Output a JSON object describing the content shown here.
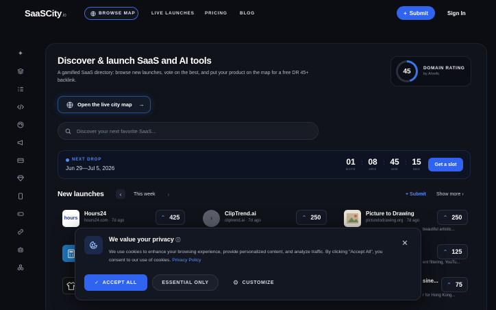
{
  "nav": {
    "logo_main": "SaaSCity",
    "logo_suffix": ".io",
    "browse_map": "BROWSE MAP",
    "live_launches": "LIVE LAUNCHES",
    "pricing": "PRICING",
    "blog": "BLOG",
    "submit": "Submit",
    "sign_in": "Sign In"
  },
  "sidebar": {
    "icons": [
      "sparkles-icon",
      "layers-icon",
      "list-check-icon",
      "code-icon",
      "palette-icon",
      "megaphone-icon",
      "credit-card-icon",
      "diamond-icon",
      "smartphone-icon",
      "gamepad-icon",
      "link-icon",
      "robot-icon",
      "shapes-icon"
    ]
  },
  "hero": {
    "title": "Discover & launch SaaS and AI tools",
    "subtitle": "A gamified SaaS directory: browse new launches, vote on the best, and put your product on the map for a free DR 45+ backlink.",
    "open_map": "Open the live city map",
    "search_placeholder": "Discover your next favorite SaaS..."
  },
  "domain_rating": {
    "value": "45",
    "label": "DOMAIN RATING",
    "by": "by Ahrefs",
    "ring_fraction": 0.45
  },
  "next_drop": {
    "tag": "NEXT DROP",
    "dates": "Jun 29—Jul 5, 2026",
    "days": "01",
    "days_label": "DAYS",
    "hrs": "08",
    "hrs_label": "HRS",
    "min": "45",
    "min_label": "MIN",
    "sec": "15",
    "sec_label": "SEC",
    "button": "Get a slot"
  },
  "launches": {
    "title": "New launches",
    "period": "This week",
    "submit": "Submit",
    "show_more": "Show more",
    "items": [
      {
        "name": "Hours24",
        "meta": "hours24.com · 7d ago",
        "votes": "425"
      },
      {
        "name": "ClipTrend.ai",
        "meta": "cliptrend.ai · 7d ago",
        "votes": "250"
      },
      {
        "name": "Picture to Drawing",
        "meta": "picturetodrawing.org · 7d ago",
        "votes": "250",
        "desc": "beautiful artistic..."
      },
      {
        "votes": "125",
        "desc": "ent filtering, YouTu..."
      },
      {
        "name": "sine...",
        "votes": "75",
        "desc": "r for Hong Kong..."
      }
    ]
  },
  "cookie": {
    "title": "We value your privacy",
    "text": "We use cookies to enhance your browsing experience, provide personalized content, and analyze traffic. By clicking \"Accept All\", you consent to our use of cookies.",
    "policy": "Privacy Policy",
    "accept": "ACCEPT ALL",
    "essential": "ESSENTIAL ONLY",
    "customize": "CUSTOMIZE"
  },
  "colors": {
    "accent": "#2f63f0",
    "background": "#0b0d12"
  }
}
